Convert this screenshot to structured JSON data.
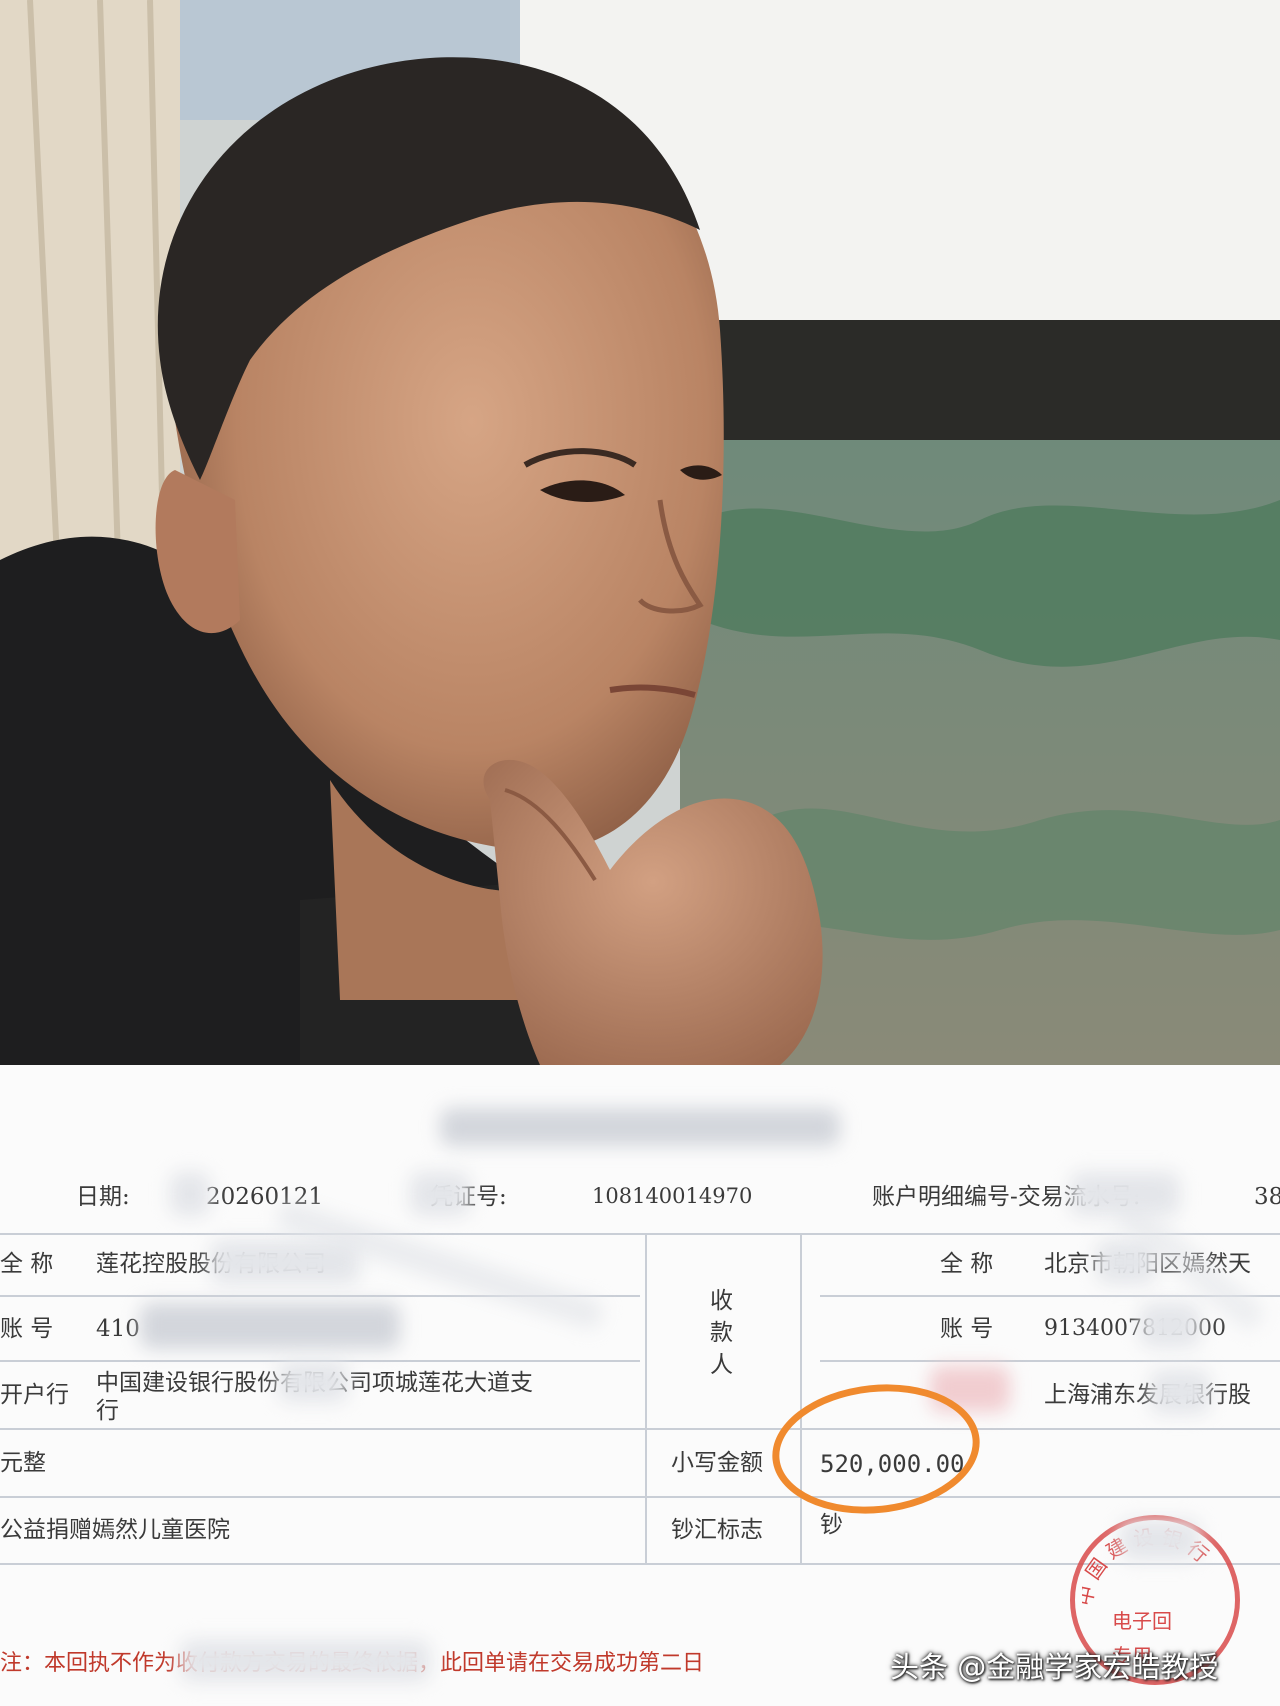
{
  "receipt": {
    "date_label": "日期:",
    "date_value": "20260121",
    "voucher_label": "凭证号:",
    "voucher_value": "108140014970",
    "detail_label": "账户明细编号-交易流水号:",
    "detail_value": "38",
    "payer": {
      "name_label": "全 称",
      "name_value": "莲花控股股份有限公司",
      "account_label": "账 号",
      "account_value": "410",
      "bank_label": "开户行",
      "bank_value_line1": "中国建设银行股份有限公司项城莲花大道支",
      "bank_value_line2": "行"
    },
    "amount_words_label": "元整",
    "purpose_value": "公益捐赠嫣然儿童医院",
    "payee_label_1": "收",
    "payee_label_2": "款",
    "payee_label_3": "人",
    "small_amount_label": "小写金额",
    "small_amount_value": "520,000.00",
    "cash_flag_label": "钞汇标志",
    "cash_flag_value": "钞",
    "payee": {
      "name_label": "全 称",
      "name_value": "北京市朝阳区嫣然天",
      "account_label": "账 号",
      "account_value": "9134007812000",
      "bank_value": "上海浦东发展银行股"
    },
    "footer_note": "注：本回执不作为收付款方交易的最终依据，此回单请在交易成功第二日",
    "seal_line1": "电子回",
    "seal_line2": "专用",
    "seal_arc": "中国建设银行"
  },
  "watermark": "头条 @金融学家宏皓教授",
  "colors": {
    "highlight_circle": "#f08a2e",
    "seal": "#d84a4a",
    "footer_text": "#c0392b"
  }
}
